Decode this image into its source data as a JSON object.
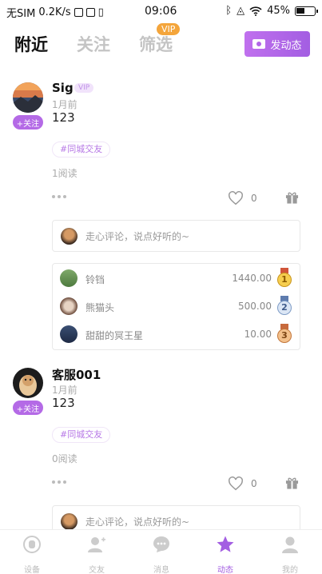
{
  "status_bar": {
    "carrier": "无SIM",
    "speed": "0.2K/s",
    "time": "09:06",
    "battery": "45%"
  },
  "header": {
    "tabs": [
      "附近",
      "关注",
      "筛选"
    ],
    "vip_badge": "VIP",
    "post_button": "发动态"
  },
  "posts": [
    {
      "username": "Sig",
      "vip_tag": "VIP",
      "follow_label": "+关注",
      "time": "1月前",
      "content": "123",
      "topic": "#同城交友",
      "reads": "1阅读",
      "likes": "0",
      "comment_placeholder": "走心评论，说点好听的~",
      "ranking": [
        {
          "name": "铃铛",
          "value": "1440.00",
          "medal": "1"
        },
        {
          "name": "熊猫头",
          "value": "500.00",
          "medal": "2"
        },
        {
          "name": "甜甜的冥王星",
          "value": "10.00",
          "medal": "3"
        }
      ]
    },
    {
      "username": "客服001",
      "follow_label": "+关注",
      "time": "1月前",
      "content": "123",
      "topic": "#同城交友",
      "reads": "0阅读",
      "likes": "0",
      "comment_placeholder": "走心评论，说点好听的~"
    }
  ],
  "bottom_nav": {
    "items": [
      "设备",
      "交友",
      "消息",
      "动态",
      "我的"
    ],
    "active": "动态"
  },
  "colors": {
    "accent": "#a35ee2",
    "vip_orange": "#f4a53b"
  }
}
